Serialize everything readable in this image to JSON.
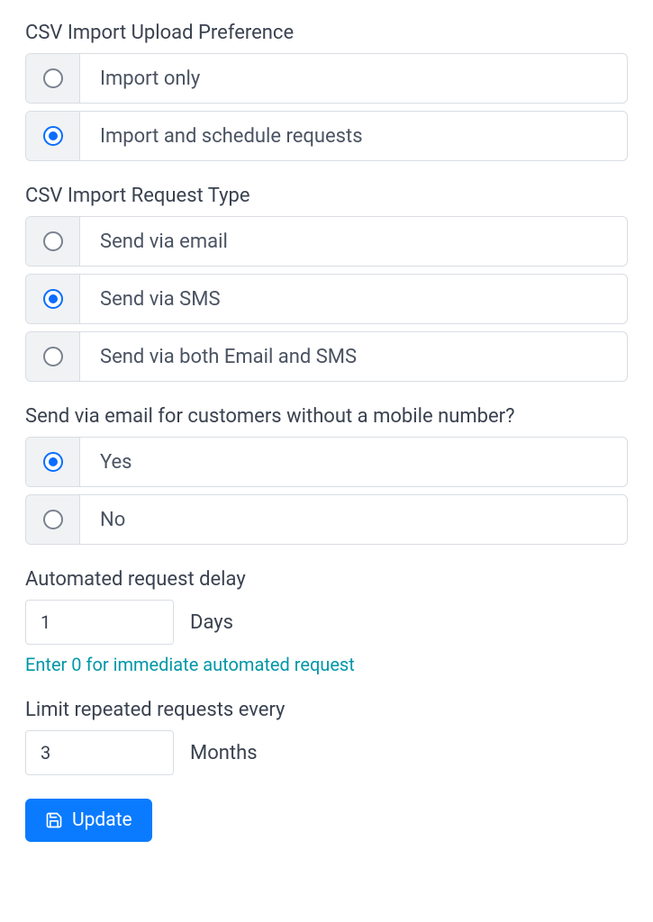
{
  "csv_upload_preference": {
    "label": "CSV Import Upload Preference",
    "options": [
      {
        "label": "Import only",
        "selected": false
      },
      {
        "label": "Import and schedule requests",
        "selected": true
      }
    ]
  },
  "csv_request_type": {
    "label": "CSV Import Request Type",
    "options": [
      {
        "label": "Send via email",
        "selected": false
      },
      {
        "label": "Send via SMS",
        "selected": true
      },
      {
        "label": "Send via both Email and SMS",
        "selected": false
      }
    ]
  },
  "send_email_fallback": {
    "label": "Send via email for customers without a mobile number?",
    "options": [
      {
        "label": "Yes",
        "selected": true
      },
      {
        "label": "No",
        "selected": false
      }
    ]
  },
  "request_delay": {
    "label": "Automated request delay",
    "value": "1",
    "unit": "Days",
    "helper": "Enter 0 for immediate automated request"
  },
  "limit_repeated": {
    "label": "Limit repeated requests every",
    "value": "3",
    "unit": "Months"
  },
  "update_button": "Update"
}
